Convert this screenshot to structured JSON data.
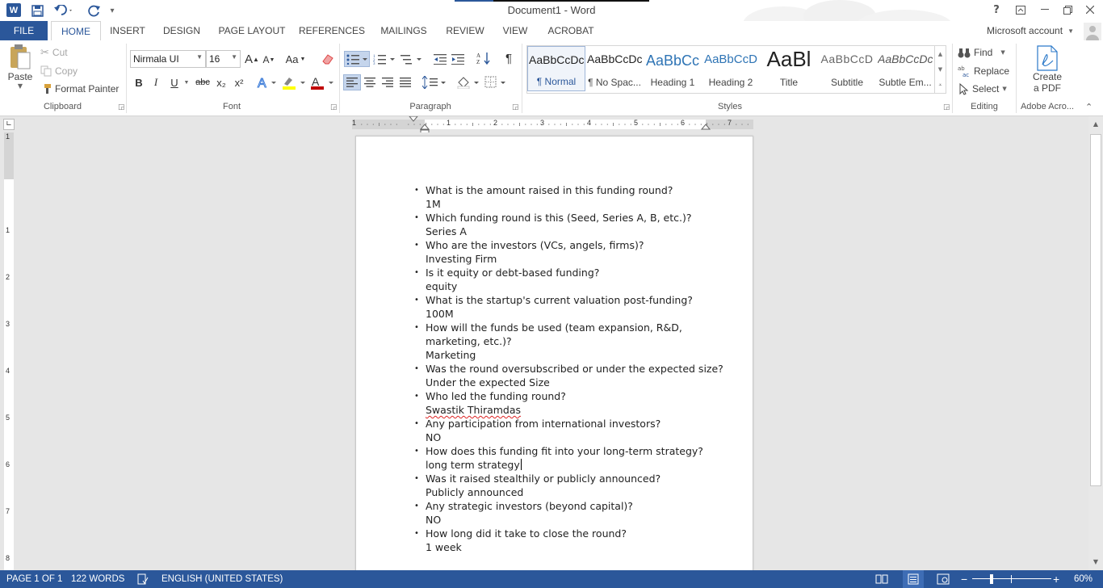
{
  "window": {
    "title": "Document1 - Word",
    "app_letter": "W"
  },
  "tabs": [
    {
      "label": "FILE"
    },
    {
      "label": "HOME"
    },
    {
      "label": "INSERT"
    },
    {
      "label": "DESIGN"
    },
    {
      "label": "PAGE LAYOUT"
    },
    {
      "label": "REFERENCES"
    },
    {
      "label": "MAILINGS"
    },
    {
      "label": "REVIEW"
    },
    {
      "label": "VIEW"
    },
    {
      "label": "ACROBAT"
    }
  ],
  "account": {
    "label": "Microsoft account"
  },
  "clipboard": {
    "paste": "Paste",
    "cut": "Cut",
    "copy": "Copy",
    "format_painter": "Format Painter",
    "group_label": "Clipboard"
  },
  "font": {
    "name": "Nirmala UI",
    "size": "16",
    "group_label": "Font",
    "bold": "B",
    "italic": "I",
    "underline": "U",
    "strike": "abc",
    "subscript": "x₂",
    "superscript": "x²",
    "grow": "A",
    "shrink": "A",
    "case": "Aa"
  },
  "paragraph": {
    "group_label": "Paragraph"
  },
  "styles": {
    "group_label": "Styles",
    "items": [
      {
        "preview": "AaBbCcDc",
        "name": "¶ Normal"
      },
      {
        "preview": "AaBbCcDc",
        "name": "¶ No Spac..."
      },
      {
        "preview": "AaBbCc",
        "name": "Heading 1"
      },
      {
        "preview": "AaBbCcD",
        "name": "Heading 2"
      },
      {
        "preview": "AaBl",
        "name": "Title"
      },
      {
        "preview": "AaBbCcD",
        "name": "Subtitle"
      },
      {
        "preview": "AaBbCcDc",
        "name": "Subtle Em..."
      }
    ]
  },
  "editing": {
    "find": "Find",
    "replace": "Replace",
    "select": "Select",
    "group_label": "Editing"
  },
  "acrobat": {
    "create_line1": "Create",
    "create_line2": "a PDF",
    "group_label": "Adobe Acro..."
  },
  "ruler": {
    "numbers": [
      "1",
      "1",
      "2",
      "3",
      "4",
      "5",
      "6",
      "7"
    ],
    "vertical_numbers": [
      "1",
      "1",
      "2",
      "3",
      "4",
      "5",
      "6",
      "7",
      "8"
    ]
  },
  "document": {
    "items": [
      {
        "q": "What is the amount raised in this funding round?",
        "a": [
          "1M"
        ]
      },
      {
        "q": "Which funding round is this (Seed, Series A, B, etc.)?",
        "a": [
          "Series A"
        ]
      },
      {
        "q": "Who are the investors (VCs, angels, firms)?",
        "a": [
          "Investing Firm"
        ]
      },
      {
        "q": "Is it equity or debt-based funding?",
        "a": [
          "equity"
        ]
      },
      {
        "q": "What is the startup's current valuation post-funding?",
        "a": [
          "100M"
        ]
      },
      {
        "q": "How will the funds be used (team expansion, R&D, marketing, etc.)?",
        "a": [
          "Marketing"
        ]
      },
      {
        "q": "Was the round oversubscribed or under the expected size?",
        "a": [
          "Under the expected Size"
        ]
      },
      {
        "q": "Who led the funding round?",
        "a": [
          "Swastik Thiramdas"
        ],
        "misspelled": true
      },
      {
        "q": "Any participation from international investors?",
        "a": [
          "NO"
        ]
      },
      {
        "q": "How does this funding fit into your long-term strategy?",
        "a": [
          "long term strategy"
        ],
        "cursor": true
      },
      {
        "q": "Was it raised stealthily or publicly announced?",
        "a": [
          "Publicly announced"
        ]
      },
      {
        "q": "Any strategic investors (beyond capital)?",
        "a": [
          "NO"
        ]
      },
      {
        "q": "How long did it take to close the round?",
        "a": [
          "1 week"
        ]
      }
    ]
  },
  "status": {
    "page": "PAGE 1 OF 1",
    "words": "122 WORDS",
    "language": "ENGLISH (UNITED STATES)",
    "zoom": "60%",
    "zoom_fraction": 0.6
  },
  "colors": {
    "accent": "#2b579a",
    "font_color": "#c00000",
    "highlight": "#ffff00"
  }
}
